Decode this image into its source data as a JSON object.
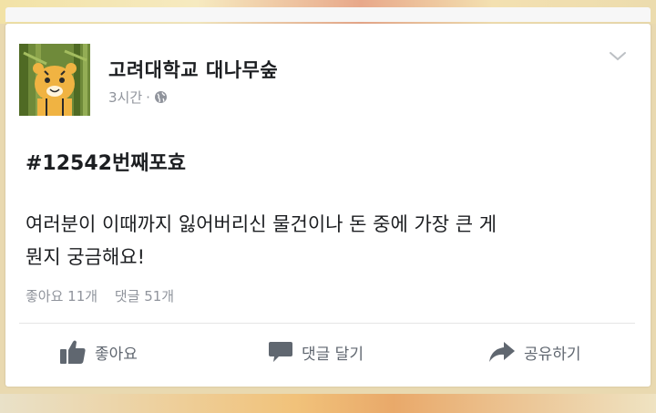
{
  "post": {
    "page_name": "고려대학교 대나무숲",
    "time_ago": "3시간",
    "separator": "·",
    "headline": "#12542번째포효",
    "body_line1": "여러분이 이때까지 잃어버리신 물건이나 돈 중에 가장 큰 게",
    "body_line2": "뭔지 궁금해요!",
    "likes_count": "좋아요 11개",
    "comments_count": "댓글 51개"
  },
  "actions": {
    "like_label": "좋아요",
    "comment_label": "댓글 달기",
    "share_label": "공유하기"
  },
  "icons": {
    "menu": "chevron-down-icon",
    "privacy": "globe-icon",
    "like": "thumbs-up-icon",
    "comment": "speech-bubble-icon",
    "share": "share-arrow-icon"
  },
  "colors": {
    "text_primary": "#1c1e21",
    "text_secondary": "#90949c",
    "action_text": "#606770",
    "card_bg": "#ffffff"
  }
}
